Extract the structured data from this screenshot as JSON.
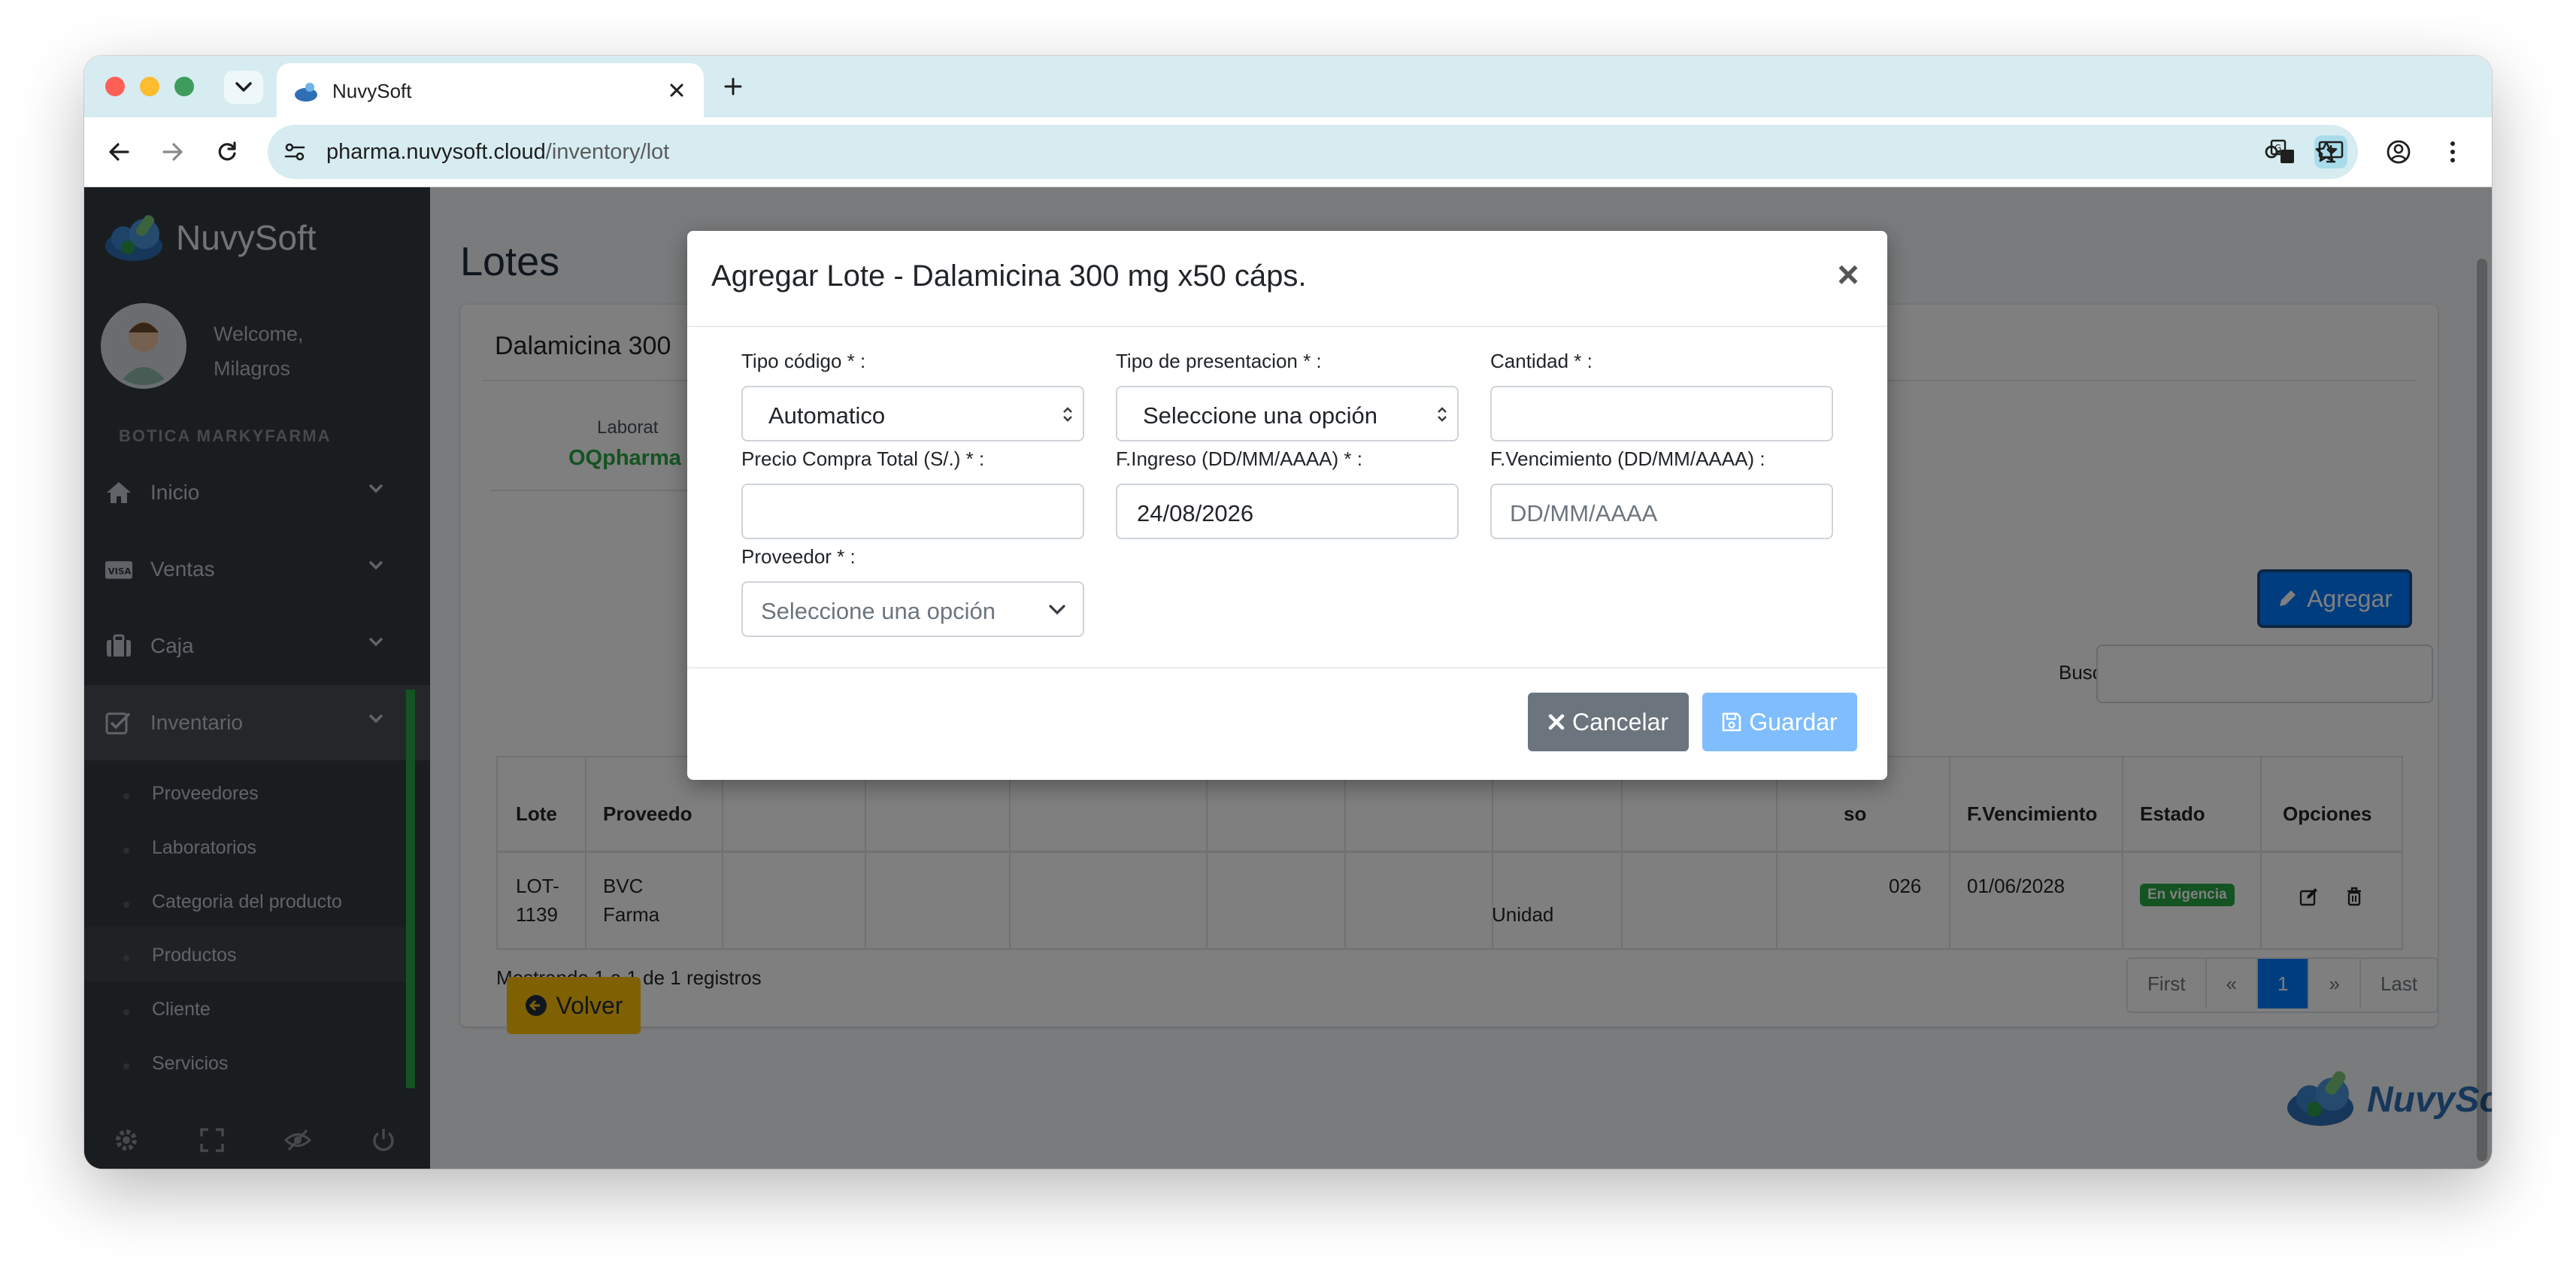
{
  "browser": {
    "tab_title": "NuvySoft",
    "url_host": "pharma.nuvysoft.cloud",
    "url_path": "/inventory/lot"
  },
  "sidebar": {
    "brand": "NuvySoft",
    "welcome_line1": "Welcome,",
    "welcome_line2": "Milagros",
    "organization": "BOTICA MARKYFARMA",
    "nav": [
      {
        "label": "Inicio",
        "icon": "home-icon"
      },
      {
        "label": "Ventas",
        "icon": "visa-card-icon"
      },
      {
        "label": "Caja",
        "icon": "briefcase-icon"
      },
      {
        "label": "Inventario",
        "icon": "checkbox-icon"
      }
    ],
    "subnav": [
      "Proveedores",
      "Laboratorios",
      "Categoria del producto",
      "Productos",
      "Cliente",
      "Servicios"
    ],
    "footer_icons": [
      "gear-icon",
      "expand-icon",
      "eye-slash-icon",
      "power-icon"
    ]
  },
  "page": {
    "title": "Lotes",
    "card_title": "Dalamicina 300",
    "lab_label": "Laborat",
    "lab_value": "OQpharma",
    "agregar_label": "Agregar",
    "buscar_label": "Buscar",
    "table": {
      "headers": [
        "Lote",
        "Proveedo",
        "so",
        "F.Vencimiento",
        "Estado",
        "Opciones"
      ],
      "row": {
        "lote_l1": "LOT-",
        "lote_l2": "1139",
        "proveedor_l1": "BVC",
        "proveedor_l2": "Farma",
        "unidad": "Unidad",
        "ingreso_partial": "026",
        "vencimiento": "01/06/2028",
        "estado": "En vigencia"
      }
    },
    "showing": "Mostrando 1 a 1 de 1 registros",
    "pagination": [
      "First",
      "«",
      "1",
      "»",
      "Last"
    ],
    "volver_label": "Volver",
    "footer_brand": "NuvySoft"
  },
  "modal": {
    "title": "Agregar Lote - Dalamicina 300 mg x50 cáps.",
    "close": "×",
    "fields": {
      "tipo_codigo": {
        "label": "Tipo código * :",
        "value": "Automatico"
      },
      "tipo_presentacion": {
        "label": "Tipo de presentacion * :",
        "placeholder": "Seleccione una opción"
      },
      "cantidad": {
        "label": "Cantidad * :",
        "value": ""
      },
      "precio": {
        "label": "Precio Compra Total (S/.) * :",
        "value": ""
      },
      "fingreso": {
        "label": "F.Ingreso (DD/MM/AAAA) * :",
        "value": "24/08/2026"
      },
      "fvencimiento": {
        "label": "F.Vencimiento (DD/MM/AAAA) :",
        "placeholder": "DD/MM/AAAA"
      },
      "proveedor": {
        "label": "Proveedor * :",
        "placeholder": "Seleccione una opción"
      }
    },
    "cancel_label": "Cancelar",
    "save_label": "Guardar"
  },
  "colors": {
    "primary": "#007bff",
    "success": "#28a745",
    "warning": "#ffc107",
    "secondary": "#6c757d",
    "sidebar": "#343a40"
  }
}
